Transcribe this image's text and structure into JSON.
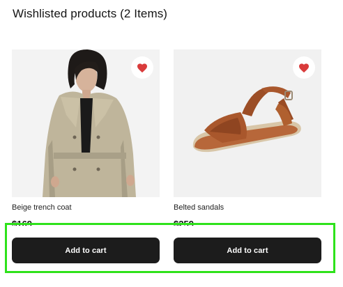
{
  "page": {
    "title": "Wishlisted products (2 Items)"
  },
  "products": [
    {
      "name": "Beige trench coat",
      "price": "$169",
      "image_alt": "Woman wearing a beige double-breasted trench coat",
      "favorite_icon": "heart-filled-icon",
      "add_to_cart_label": "Add to cart"
    },
    {
      "name": "Belted sandals",
      "price": "$259",
      "image_alt": "Brown leather belted sandal",
      "favorite_icon": "heart-filled-icon",
      "add_to_cart_label": "Add to cart"
    }
  ],
  "colors": {
    "heart": "#d93b3b",
    "button_bg": "#1c1c1c",
    "image_bg": "#f1f1f1",
    "highlight": "#2ee21b"
  }
}
